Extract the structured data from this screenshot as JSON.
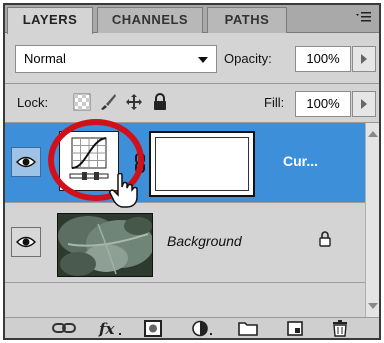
{
  "tabs": [
    {
      "label": "LAYERS",
      "active": true
    },
    {
      "label": "CHANNELS",
      "active": false
    },
    {
      "label": "PATHS",
      "active": false
    }
  ],
  "blend_mode": "Normal",
  "opacity": {
    "label": "Opacity:",
    "value": "100%"
  },
  "lock": {
    "label": "Lock:"
  },
  "fill": {
    "label": "Fill:",
    "value": "100%"
  },
  "layers": [
    {
      "name": "Cur...",
      "selected": true,
      "type": "adjustment-curves"
    },
    {
      "name": "Background",
      "selected": false,
      "locked": true
    }
  ],
  "colors": {
    "selection": "#3d8fd9",
    "highlight_circle": "#d0101a"
  },
  "icons": [
    "panel-menu-icon",
    "eye-icon",
    "curves-icon",
    "link-icon",
    "lock-icon",
    "fx-icon",
    "mask-icon",
    "adjustment-icon",
    "folder-icon",
    "new-layer-icon",
    "trash-icon",
    "hand-cursor-icon"
  ]
}
